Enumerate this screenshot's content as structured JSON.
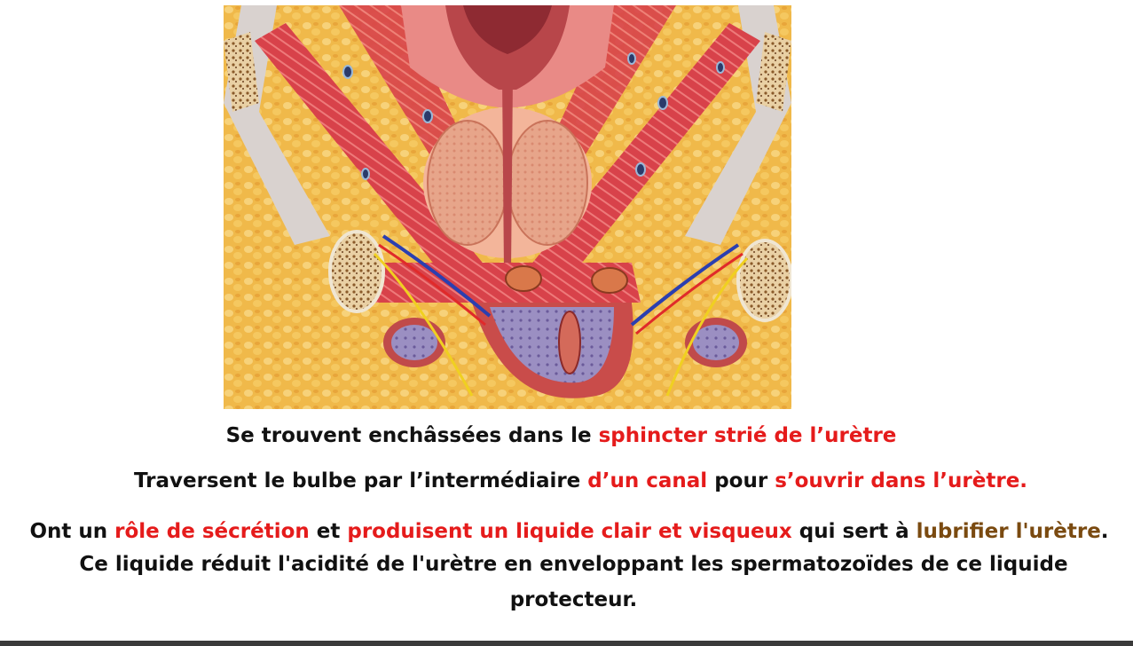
{
  "slide": {
    "line1": {
      "a": "Se trouvent enchâssées dans le ",
      "b": "sphincter strié de l’urètre"
    },
    "line2": {
      "a": "Traversent le bulbe par l’intermédiaire ",
      "b": "d’un canal",
      "c": " pour ",
      "d": "s’ouvrir dans l’urètre."
    },
    "line3": {
      "a": "Ont un ",
      "b": "rôle de sécrétion",
      "c": " et ",
      "d": "produisent un liquide clair et visqueux",
      "e": " qui sert à ",
      "f": "lubrifier l'urètre",
      "g": "."
    },
    "line4": "Ce liquide réduit l'acidité de l'urètre en enveloppant les spermatozoïdes de ce liquide",
    "line5": "protecteur."
  },
  "colors": {
    "highlight": "#e51b1b",
    "accent_brown": "#7a4a10",
    "text": "#111111"
  }
}
